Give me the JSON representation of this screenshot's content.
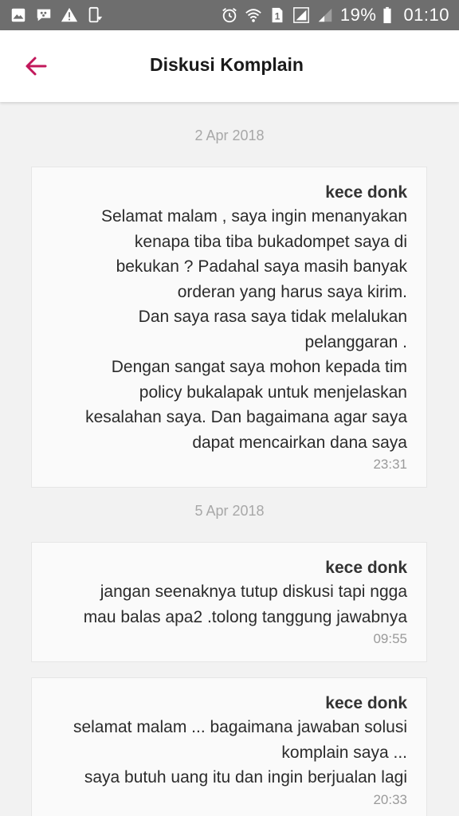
{
  "status_bar": {
    "battery": "19%",
    "time": "01:10",
    "sim_slot": "1",
    "left_icons": [
      "gallery-icon",
      "bbm-icon",
      "warning-icon",
      "device-download-icon"
    ],
    "right_icons": [
      "alarm-icon",
      "wifi-icon",
      "sim-icon",
      "signal-icon",
      "signal-icon",
      "battery-icon"
    ]
  },
  "header": {
    "title": "Diskusi Komplain",
    "back_icon": "arrow-left-icon",
    "accent_color": "#c2185b"
  },
  "thread": [
    {
      "date": "2 Apr 2018",
      "messages": [
        {
          "sender": "kece donk",
          "text": "Selamat malam , saya ingin menanyakan\nkenapa tiba tiba bukadompet saya di\nbekukan ? Padahal saya masih banyak\norderan yang harus saya kirim.\nDan saya rasa saya tidak melalukan\npelanggaran .\nDengan sangat saya mohon kepada tim\npolicy bukalapak untuk menjelaskan\nkesalahan saya. Dan bagaimana agar saya\ndapat mencairkan dana saya",
          "time": "23:31"
        }
      ]
    },
    {
      "date": "5 Apr 2018",
      "messages": [
        {
          "sender": "kece donk",
          "text": "jangan seenaknya tutup diskusi tapi ngga\nmau balas apa2 .tolong tanggung jawabnya",
          "time": "09:55"
        },
        {
          "sender": "kece donk",
          "text": "selamat malam ... bagaimana jawaban solusi\nkomplain saya ...\nsaya butuh uang itu dan ingin berjualan lagi",
          "time": "20:33"
        }
      ]
    }
  ]
}
